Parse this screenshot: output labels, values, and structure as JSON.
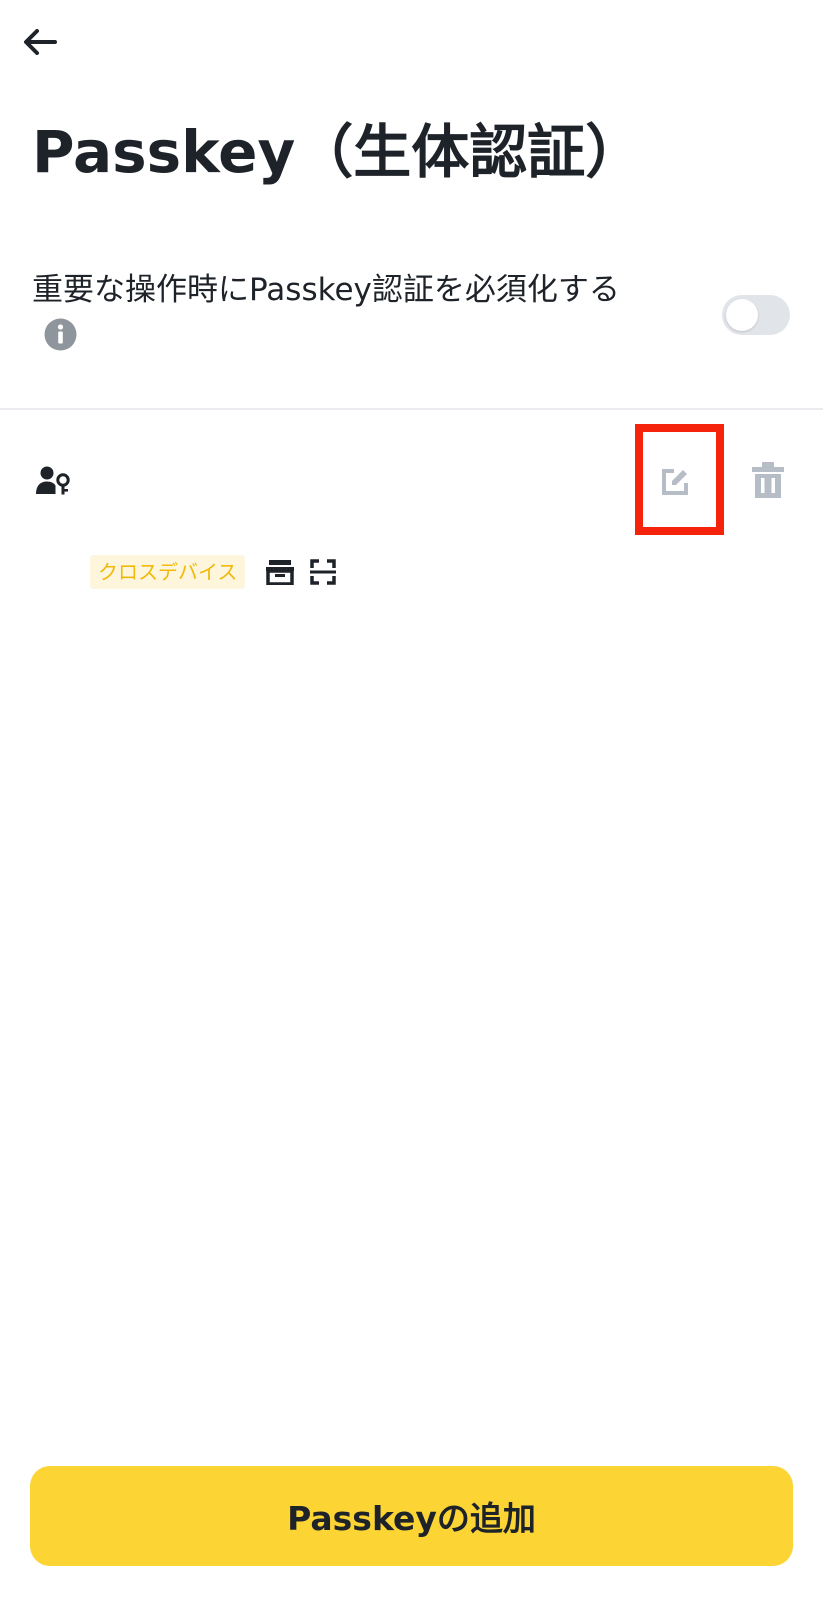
{
  "header": {
    "back_icon": "arrow-left-icon",
    "title": "Passkey（生体認証）"
  },
  "setting": {
    "label": "重要な操作時にPasskey認証を必須化する",
    "info_icon": "info-icon",
    "toggle_on": false
  },
  "passkey_item": {
    "icon": "user-key-icon",
    "tag": "クロスデバイス",
    "device_icon": "device-box-icon",
    "face_icon": "face-scan-icon",
    "edit_icon": "edit-icon",
    "delete_icon": "trash-icon"
  },
  "footer": {
    "add_button_label": "Passkeyの追加"
  },
  "colors": {
    "accent": "#fcd535",
    "text": "#1e2329",
    "muted_icon": "#b7bdc6",
    "tag_bg": "#fdf6dc",
    "tag_text": "#f0b90b",
    "highlight": "#f5220c",
    "toggle_off": "#e1e4e8"
  }
}
